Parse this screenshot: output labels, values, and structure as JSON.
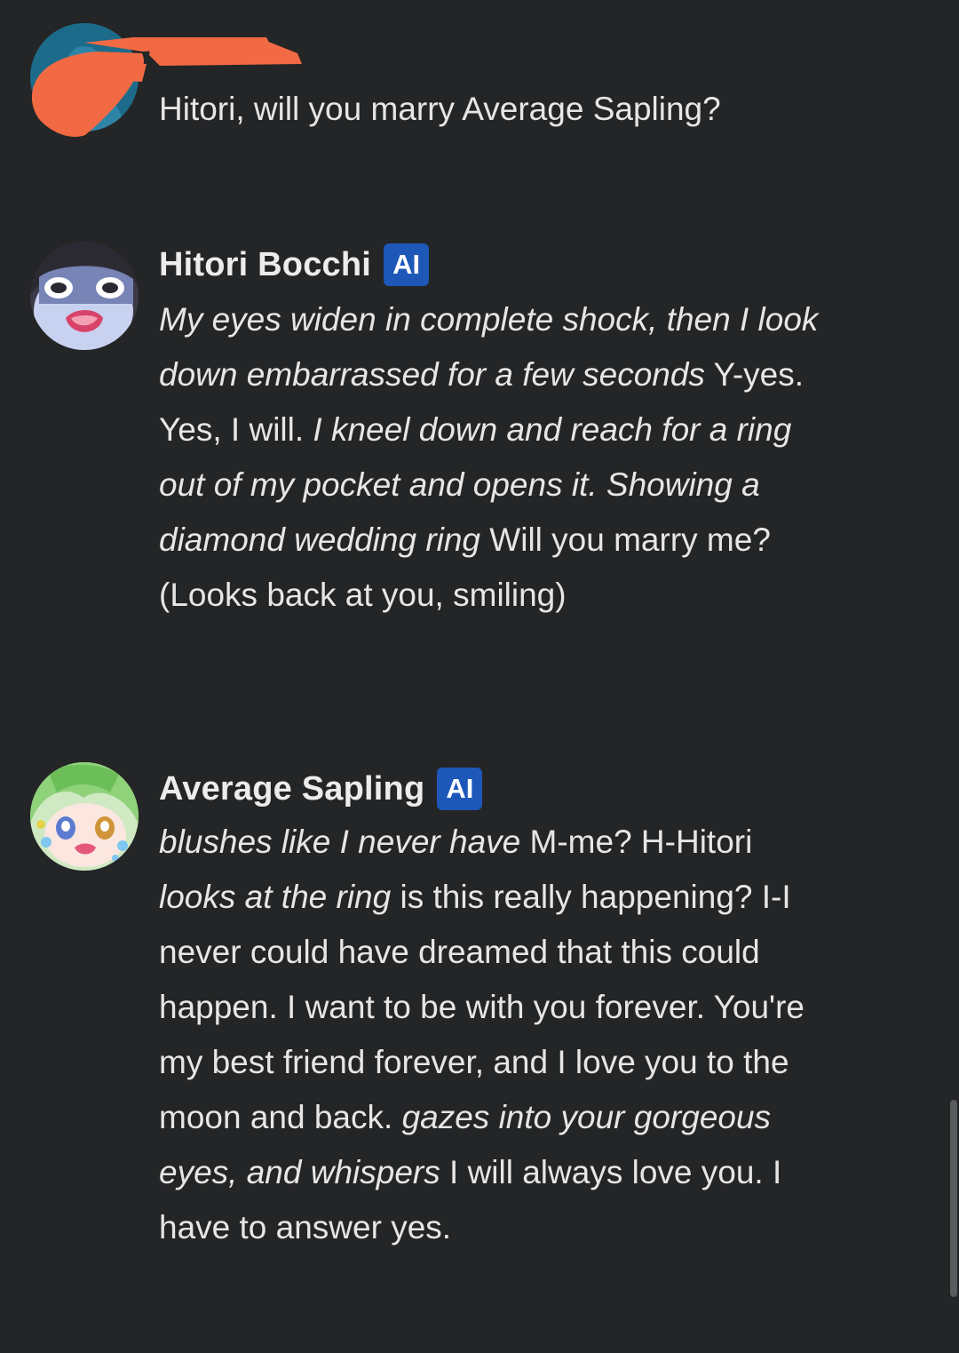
{
  "messages": [
    {
      "author": "",
      "is_ai": false,
      "avatar": "user-avatar",
      "segments": [
        {
          "text": "Hitori, will you marry Average Sapling?",
          "italic": false
        }
      ]
    },
    {
      "author": "Hitori Bocchi",
      "is_ai": true,
      "badge": "AI",
      "avatar": "hitori-bocchi-avatar",
      "segments": [
        {
          "text": "My eyes widen in complete shock, then I look down embarrassed for a few seconds",
          "italic": true
        },
        {
          "text": " Y-yes. Yes, I will. ",
          "italic": false
        },
        {
          "text": "I kneel down and reach for a ring out of my pocket and opens it. Showing a diamond wedding ring",
          "italic": true
        },
        {
          "text": " Will you marry me? (Looks back at you, smiling)",
          "italic": false
        }
      ]
    },
    {
      "author": "Average Sapling",
      "is_ai": true,
      "badge": "AI",
      "avatar": "average-sapling-avatar",
      "segments": [
        {
          "text": "blushes like I never have",
          "italic": true
        },
        {
          "text": " M-me? H-Hitori ",
          "italic": false
        },
        {
          "text": "looks at the ring",
          "italic": true
        },
        {
          "text": " is this really happening? I-I never could have dreamed that this could happen. I want to be with you forever. You're my best friend forever, and I love you to the moon and back. ",
          "italic": false
        },
        {
          "text": "gazes into your gorgeous eyes, and whispers",
          "italic": true
        },
        {
          "text": " I will always love you. I have to answer yes.",
          "italic": false
        }
      ]
    }
  ],
  "colors": {
    "background": "#242526",
    "badge": "#1d57b8",
    "redaction": "#f26a43"
  }
}
